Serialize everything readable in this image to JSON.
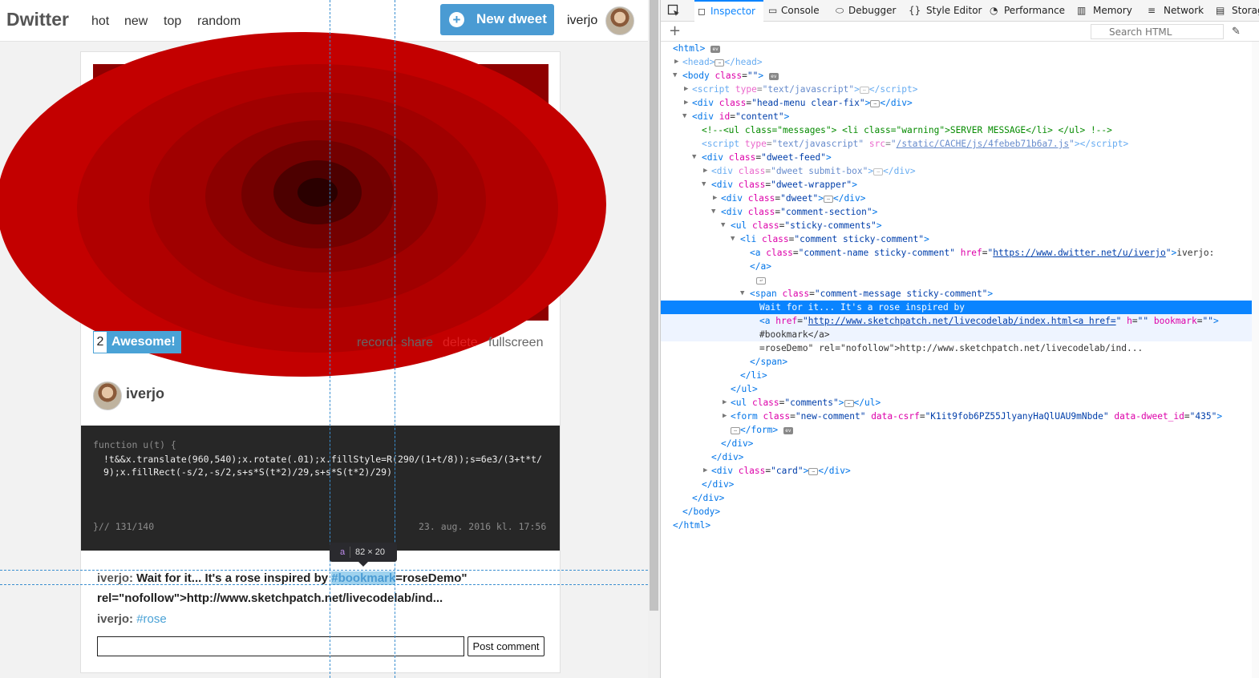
{
  "site": {
    "logo": "Dwitter",
    "nav": [
      "hot",
      "new",
      "top",
      "random"
    ],
    "new_dweet_label": "New dweet",
    "new_dweet_icon": "plus-icon",
    "username": "iverjo"
  },
  "dweet": {
    "awesome_count": "2",
    "awesome_label": "Awesome!",
    "actions": {
      "record": "record",
      "share": "share",
      "delete": "delete",
      "fullscreen": "fullscreen"
    },
    "author": "iverjo",
    "code_header": "function u(t) {",
    "code_line1": "!t&&x.translate(960,540);x.rotate(.01);x.fillStyle=R(290/(1+t/8));s=6e3/(3+t*t/",
    "code_line2": "9);x.fillRect(-s/2,-s/2,s+s*S(t*2)/29,s+s*S(t*2)/29)",
    "code_footer": "}// 131/140",
    "date": "23. aug. 2016 kl. 17:56"
  },
  "comments": {
    "c1_name": "iverjo:",
    "c1_text_a": " Wait for it... It's a rose inspired by ",
    "c1_link": "#bookmark",
    "c1_text_b": "=roseDemo\"",
    "c1_text_c": "rel=\"nofollow\">http://www.sketchpatch.net/livecodelab/ind...",
    "c2_name": "iverjo:",
    "c2_tag": "#rose",
    "post_label": "Post comment"
  },
  "highlight_tooltip": {
    "tag": "a",
    "size": "82 × 20"
  },
  "devtools": {
    "tabs": [
      "Inspector",
      "Console",
      "Debugger",
      "Style Editor",
      "Performance",
      "Memory",
      "Network",
      "Storag"
    ],
    "tab_icons": [
      "inspector-icon",
      "console-icon",
      "debugger-icon",
      "style-editor-icon",
      "performance-icon",
      "memory-icon",
      "network-icon",
      "storage-icon"
    ],
    "search_placeholder": "Search HTML",
    "colors": {
      "tag": "#0074e8",
      "attr": "#dd00a9",
      "value": "#003eaa",
      "comment": "#058b00",
      "selected": "#0a84ff"
    },
    "tree": {
      "l1": "<html>",
      "l2": "<head>",
      "l2b": "</head>",
      "l3": "<body",
      "l4a": "<script",
      "l5": "<div",
      "l6": "<div",
      "l7": "<!--<ul class=\"messages\"> <li class=\"warning\">SERVER MESSAGE</li> </ul> !-->",
      "l8a": "<script",
      "l8link": "/static/CACHE/js/4febeb71b6a7.js",
      "l9": "<div",
      "l10": "<div",
      "l11": "<div",
      "l12": "<div",
      "l13": "<div",
      "l14": "<ul",
      "l15": "<li",
      "l16a": "<a",
      "l16link": "https://www.dwitter.net/u/iverjo",
      "l16b": "iverjo:",
      "l17": "</a>",
      "l19": "<span",
      "l20": "Wait for it... It's a rose inspired by",
      "l21a": "<a",
      "l21link": "http://www.sketchpatch.net/livecodelab/index.html<a href=",
      "l22": "#bookmark</a>",
      "l23": "=roseDemo\" rel=\"nofollow\">http://www.sketchpatch.net/livecodelab/ind...",
      "l24": "</span>",
      "l25": "</li>",
      "l26": "</ul>",
      "l27": "<ul",
      "l28": "<form",
      "l29": "</form>",
      "l30": "</div>",
      "l31": "</div>",
      "l32": "<div",
      "l33": "</div>",
      "l34": "</div>",
      "l35": "</body>",
      "l36": "</html>"
    }
  }
}
